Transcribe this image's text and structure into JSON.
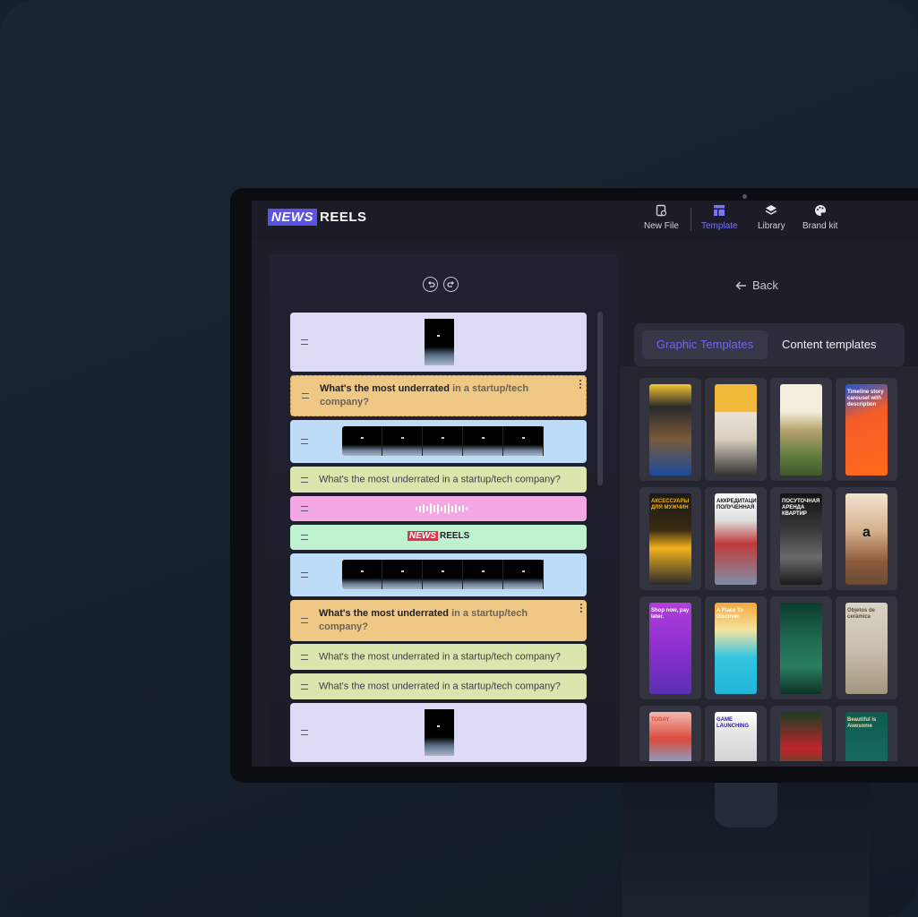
{
  "brand": {
    "logo_news": "NEWS",
    "logo_reels": "REELS"
  },
  "nav": {
    "items": [
      {
        "label": "New File",
        "icon": "new-file-icon",
        "active": false
      },
      {
        "label": "Template",
        "icon": "template-icon",
        "active": true
      },
      {
        "label": "Library",
        "icon": "layers-icon",
        "active": false
      },
      {
        "label": "Brand kit",
        "icon": "palette-icon",
        "active": false
      }
    ]
  },
  "editor": {
    "blocks": [
      {
        "type": "image",
        "color": "#dcdaf4"
      },
      {
        "type": "title",
        "color": "#f0c885",
        "bold": "What's the most underrated",
        "rest": " in a startup/tech company?"
      },
      {
        "type": "filmstrip",
        "color": "#bcdcf7"
      },
      {
        "type": "text",
        "color": "#dbe5ae",
        "text": "What's the most underrated in a startup/tech company?"
      },
      {
        "type": "audio",
        "color": "#f4a8e3"
      },
      {
        "type": "logo",
        "color": "#bff2cf",
        "logo_news": "NEWS",
        "logo_reels": "REELS"
      },
      {
        "type": "filmstrip",
        "color": "#bcdcf7"
      },
      {
        "type": "title",
        "color": "#f0c885",
        "bold": "What's the most underrated",
        "rest": " in a startup/tech company?"
      },
      {
        "type": "text",
        "color": "#dbe5ae",
        "text": "What's the most underrated in a startup/tech company?"
      },
      {
        "type": "text",
        "color": "#dbe5ae",
        "text": "What's the most underrated in a startup/tech company?"
      },
      {
        "type": "image",
        "color": "#dcdaf4"
      }
    ]
  },
  "panel": {
    "back_label": "Back",
    "tabs": [
      {
        "label": "Graphic Templates",
        "active": true
      },
      {
        "label": "Content templates",
        "active": false
      }
    ],
    "templates": [
      {
        "bg": "linear-gradient(180deg,#f4c430 0%,#2a2a2a 25%,#7a5a3a 60%,#1b4b9c 100%)",
        "caption": "",
        "fg": "#fff"
      },
      {
        "bg": "linear-gradient(180deg,#f2b83a 0%,#f2b83a 30%,#e8e2d6 31%,#d9cfbf 60%,#333 100%)",
        "caption": "",
        "fg": "#fff"
      },
      {
        "bg": "linear-gradient(180deg,#f4efdd 0%,#f4efdd 30%,#b7a46e 50%,#5d7a3c 80%,#3e5a2a 100%)",
        "caption": "",
        "fg": "#6a5b3a"
      },
      {
        "bg": "linear-gradient(160deg,#1f56d8 0%,#f45c2a 35%,#ff6a1a 100%)",
        "caption": "Timeline story carousel with description",
        "fg": "#fff"
      },
      {
        "bg": "linear-gradient(180deg,#1a1a1a 0%,#3a2a10 40%,#f2b21b 60%,#2b2b2b 100%)",
        "caption": "АКСЕССУАРЫ ДЛЯ МУЖЧИН",
        "fg": "#f2b21b"
      },
      {
        "bg": "linear-gradient(180deg,#fff 0%,#ddd 30%,#c03a3a 55%,#7f8ea6 100%)",
        "caption": "АККРЕДИТАЦИЯ ПОЛУЧЕННАЯ",
        "fg": "#111"
      },
      {
        "bg": "linear-gradient(180deg,#111 0%,#3a3a3a 40%,#6a6a6a 70%,#1a1a1a 100%)",
        "caption": "ПОСУТОЧНАЯ АРЕНДА КВАРТИР",
        "fg": "#fff"
      },
      {
        "bg": "linear-gradient(180deg,#f3e3cf 0%,#d7b28f 40%,#8b5a3c 75%,#6a4a35 100%)",
        "caption": "a",
        "fg": "#111"
      },
      {
        "bg": "linear-gradient(180deg,#b03fd8 0%,#8c2fd0 50%,#5a2fb0 100%)",
        "caption": "Shop now, pay later.",
        "fg": "#fff"
      },
      {
        "bg": "linear-gradient(180deg,#f7a83a 0%,#f4e3a0 30%,#32c5e0 60%,#22b5d6 100%)",
        "caption": "A Place To Discover",
        "fg": "#fff"
      },
      {
        "bg": "linear-gradient(180deg,#0b3b2e 0%,#1f6a4f 40%,#2a7f5f 70%,#0e3324 100%)",
        "caption": "",
        "fg": "#9f9"
      },
      {
        "bg": "linear-gradient(180deg,#d9d3c5 0%,#c9bfae 50%,#a3967f 100%)",
        "caption": "Objetos de cerámica",
        "fg": "#5a4e3c"
      },
      {
        "bg": "linear-gradient(180deg,#f4b9b0 0%,#d94b3c 30%,#7ab0e3 60%,#eee 100%)",
        "caption": "TODAY",
        "fg": "#d94b3c"
      },
      {
        "bg": "linear-gradient(180deg,#ffffff 0%,#e8e8e8 20%,#cfcfcf 60%,#e04b6a 100%)",
        "caption": "GAME LAUNCHING",
        "fg": "#2a1aa8"
      },
      {
        "bg": "linear-gradient(180deg,#1a3f23 0%,#c0242a 40%,#2a5a2a 70%,#1a3a1a 100%)",
        "caption": "",
        "fg": "#fff"
      },
      {
        "bg": "linear-gradient(180deg,#0f5a4f 0%,#146a5c 50%,#0d4a40 100%)",
        "caption": "Beautiful is Awesome",
        "fg": "#f3d9a8"
      }
    ]
  }
}
